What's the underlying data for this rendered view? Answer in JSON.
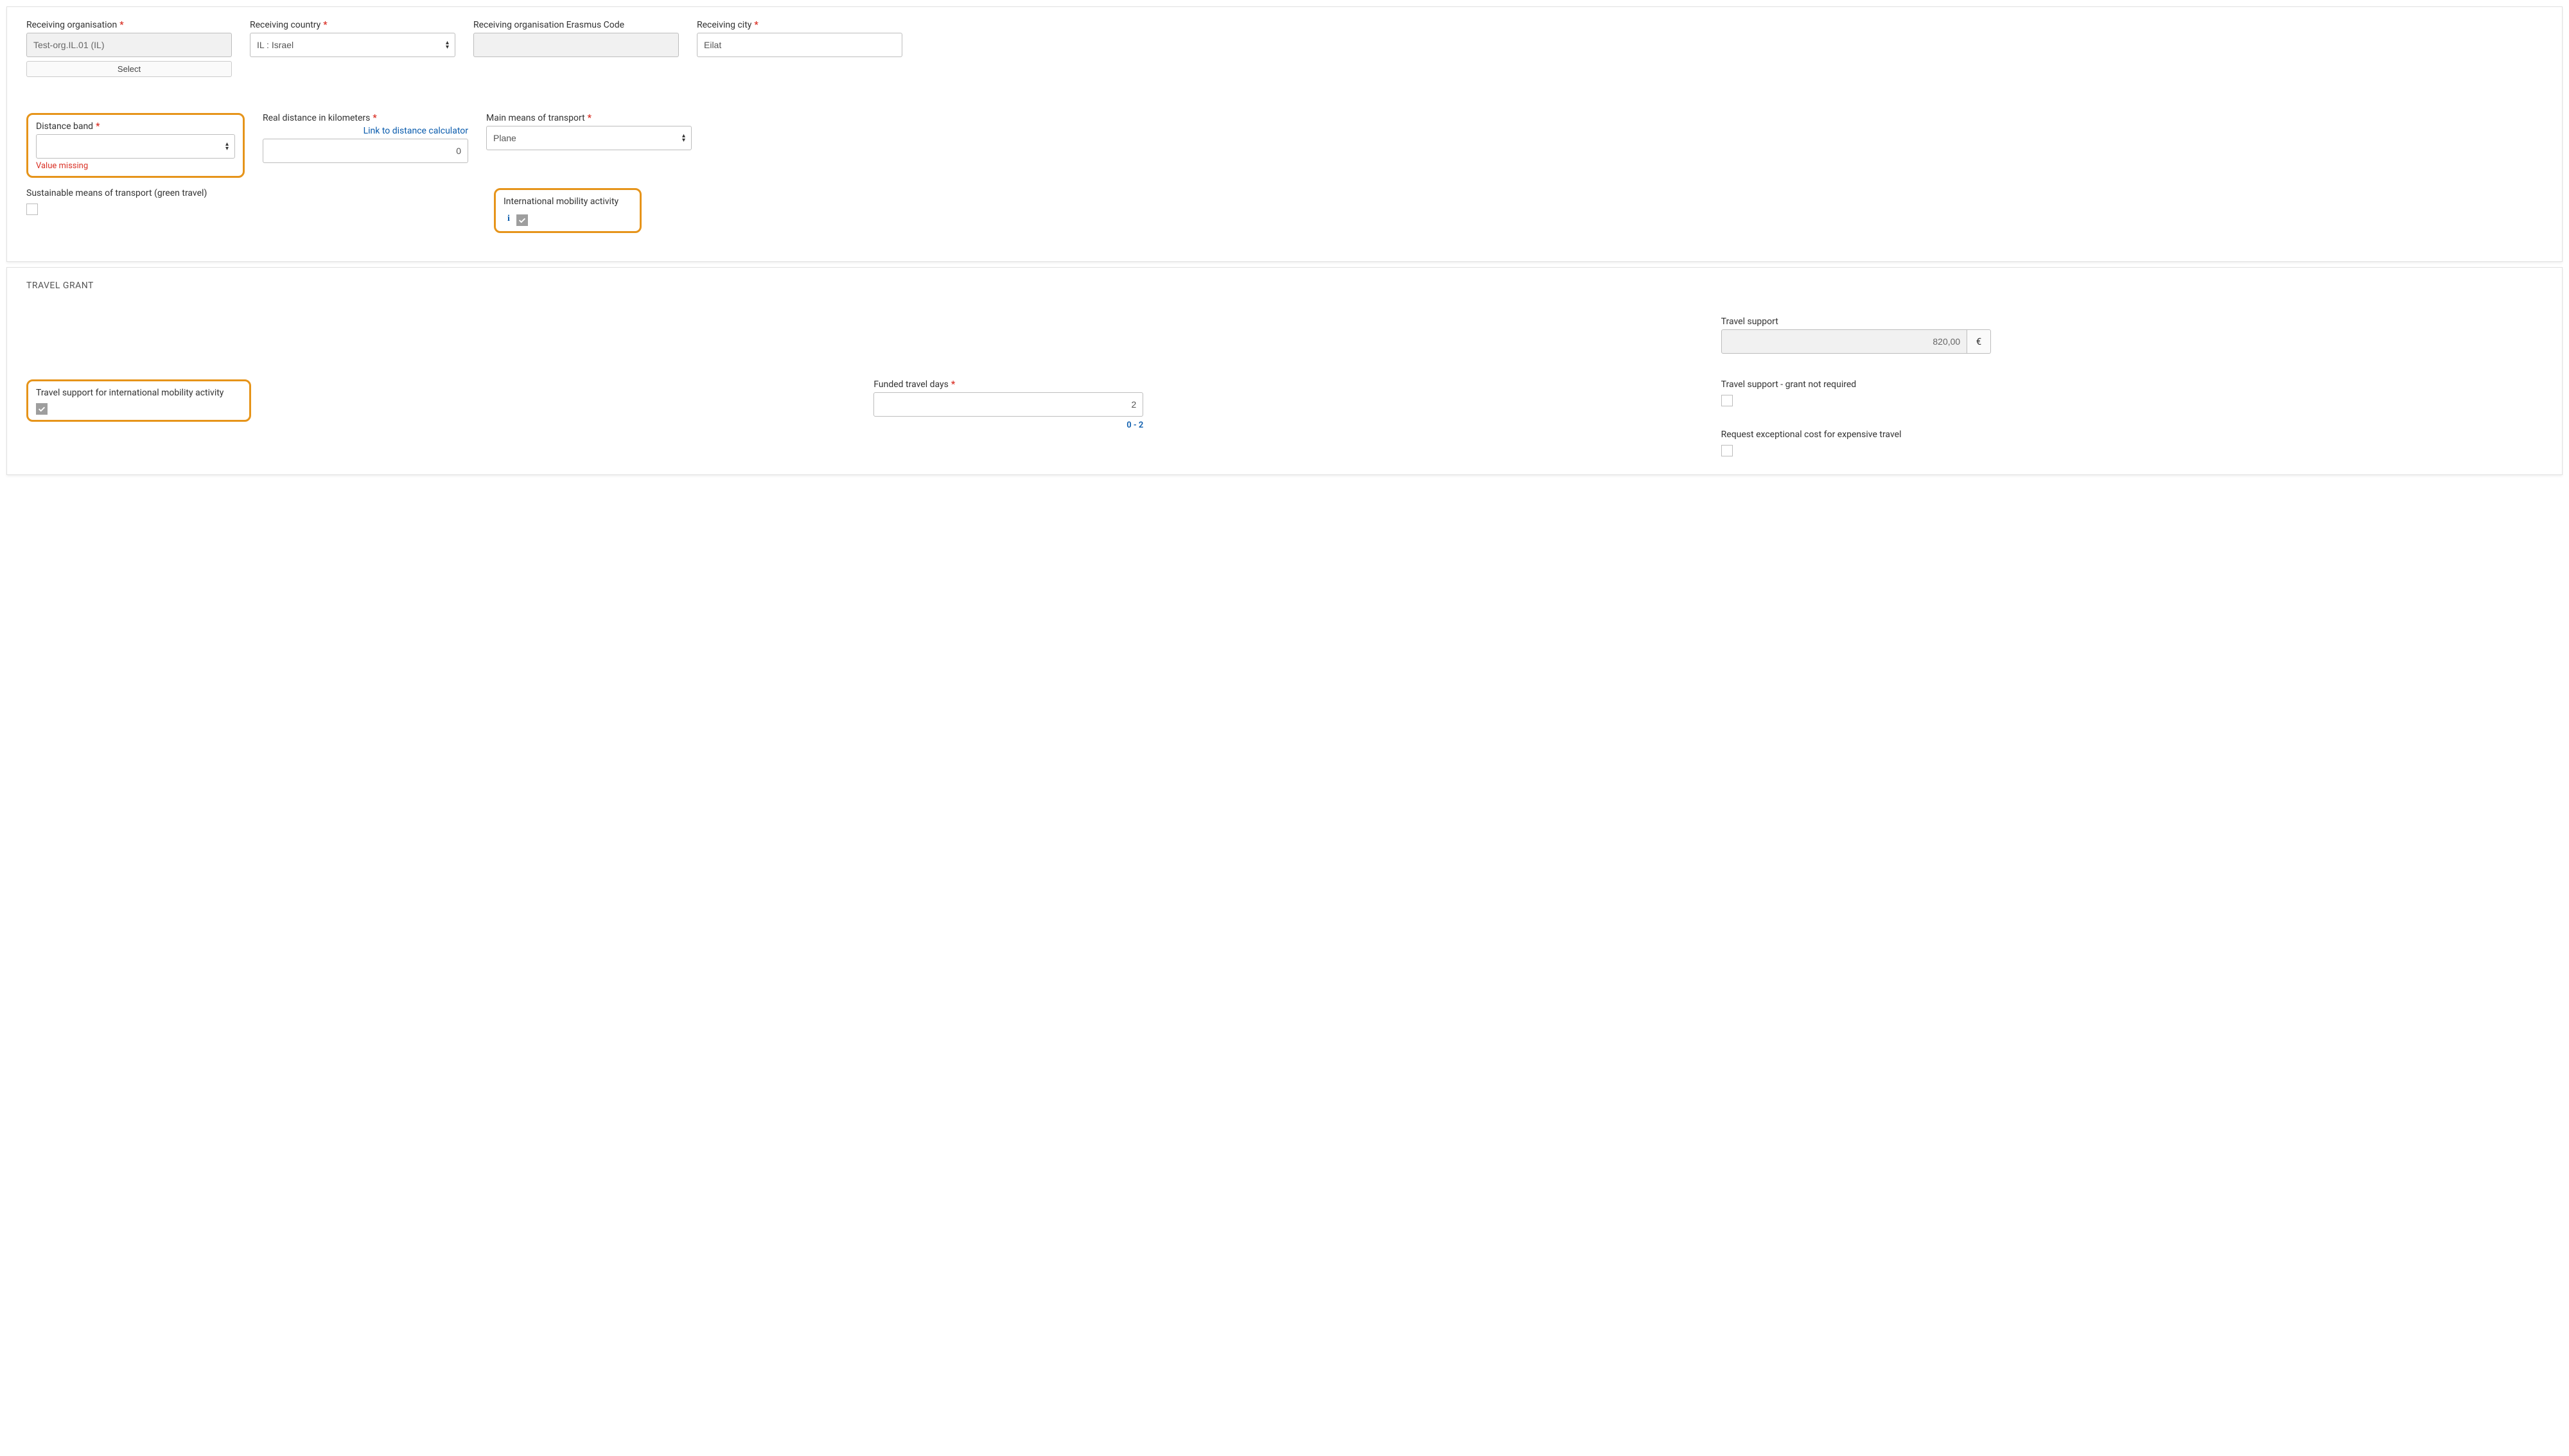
{
  "section1": {
    "receivingOrg": {
      "label": "Receiving organisation",
      "value": "Test-org.IL.01 (IL)",
      "selectBtn": "Select"
    },
    "receivingCountry": {
      "label": "Receiving country",
      "value": "IL : Israel"
    },
    "erasmusCode": {
      "label": "Receiving organisation Erasmus Code",
      "value": ""
    },
    "receivingCity": {
      "label": "Receiving city",
      "value": "Eilat"
    },
    "distanceBand": {
      "label": "Distance band",
      "value": "",
      "error": "Value missing"
    },
    "realDistance": {
      "label": "Real distance in kilometers",
      "link": "Link to distance calculator",
      "value": "0"
    },
    "transport": {
      "label": "Main means of transport",
      "value": "Plane"
    },
    "sustainable": {
      "label": "Sustainable means of transport (green travel)"
    },
    "intlMobility": {
      "label": "International mobility activity"
    }
  },
  "section2": {
    "title": "TRAVEL GRANT",
    "travelSupport": {
      "label": "Travel support",
      "value": "820,00",
      "currency": "€"
    },
    "travelSupportIntl": {
      "label": "Travel support for international mobility activity"
    },
    "fundedDays": {
      "label": "Funded travel days",
      "value": "2",
      "range": "0 - 2"
    },
    "grantNotRequired": {
      "label": "Travel support - grant not required"
    },
    "exceptionalCost": {
      "label": "Request exceptional cost for expensive travel"
    }
  }
}
